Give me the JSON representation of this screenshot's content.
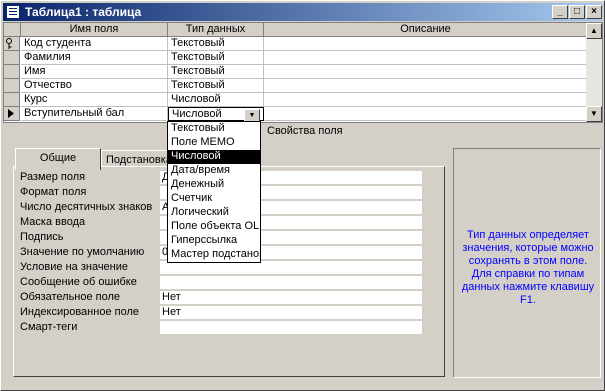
{
  "window": {
    "title": "Таблица1 : таблица"
  },
  "grid": {
    "headers": [
      "Имя поля",
      "Тип данных",
      "Описание"
    ],
    "rows": [
      {
        "name": "Код студента",
        "type": "Текстовый"
      },
      {
        "name": "Фамилия",
        "type": "Текстовый"
      },
      {
        "name": "Имя",
        "type": "Текстовый"
      },
      {
        "name": "Отчество",
        "type": "Текстовый"
      },
      {
        "name": "Курс",
        "type": "Числовой"
      },
      {
        "name": "Вступительный бал",
        "type": "Числовой"
      }
    ]
  },
  "props": {
    "title": "Свойства поля",
    "tabs": [
      "Общие",
      "Подстановка"
    ],
    "labels": [
      "Размер поля",
      "Формат поля",
      "Число десятичных знаков",
      "Маска ввода",
      "Подпись",
      "Значение по умолчанию",
      "Условие на значение",
      "Сообщение об ошибке",
      "Обязательное поле",
      "Индексированное поле",
      "Смарт-теги"
    ],
    "values": [
      "Д",
      "",
      "А",
      "",
      "",
      "0",
      "",
      "",
      "Нет",
      "Нет",
      ""
    ]
  },
  "help": "Тип данных определяет значения, которые можно сохранять в этом поле.  Для справки по типам данных нажмите клавишу F1.",
  "dropdown": {
    "options": [
      "Текстовый",
      "Поле MEMO",
      "Числовой",
      "Дата/время",
      "Денежный",
      "Счетчик",
      "Логический",
      "Поле объекта OLE",
      "Гиперссылка",
      "Мастер подстановок..."
    ]
  }
}
